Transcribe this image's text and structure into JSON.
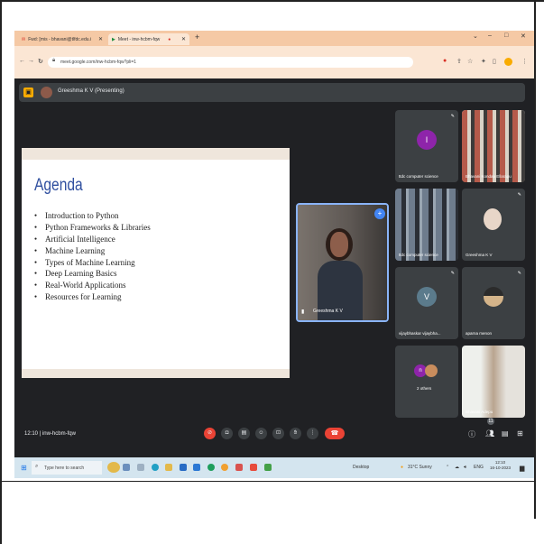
{
  "browser": {
    "tabs": [
      {
        "label": "Fwd: [mis - bhavani@tlfdc.edu.i"
      },
      {
        "label": "Meet - inw-hcbm-fqw"
      }
    ],
    "url": "meet.google.com/inw-hcbm-fqw?pli=1"
  },
  "meet": {
    "presenting_label": "Greeshma K V (Presenting)",
    "slide": {
      "title": "Agenda",
      "items": [
        "Introduction to Python",
        "Python Frameworks & Libraries",
        "Artificial Intelligence",
        "Machine Learning",
        "Types of Machine Learning",
        "Deep Learning Basics",
        "Real-World Applications",
        "Resources for Learning"
      ]
    },
    "speaker": {
      "name": "Greeshma K V"
    },
    "participants": [
      {
        "name": "ttdc computer science",
        "initial": "I",
        "color": "#8e24aa"
      },
      {
        "name": "Bhavani Kondaa Ellarapu",
        "initial": "",
        "color": ""
      },
      {
        "name": "ttdc computer science",
        "initial": "",
        "color": ""
      },
      {
        "name": "Greeshma K V",
        "initial": "",
        "color": ""
      },
      {
        "name": "vijaybhaskar vijaybha...",
        "initial": "V",
        "color": "#5b7b8c"
      },
      {
        "name": "aparna menon",
        "initial": "",
        "color": ""
      },
      {
        "name": "2 others",
        "initial": "n",
        "color": "#8e24aa"
      },
      {
        "name": "Bhavani Adepu",
        "initial": "",
        "color": ""
      }
    ],
    "meeting_time": "12:10",
    "meeting_code": "inw-hcbm-fqw",
    "people_count": "11"
  },
  "taskbar": {
    "search_placeholder": "Type here to search",
    "desktop_label": "Desktop",
    "weather": "31°C Sunny",
    "language": "ENG",
    "time": "12:10",
    "date": "16-10-2023"
  }
}
